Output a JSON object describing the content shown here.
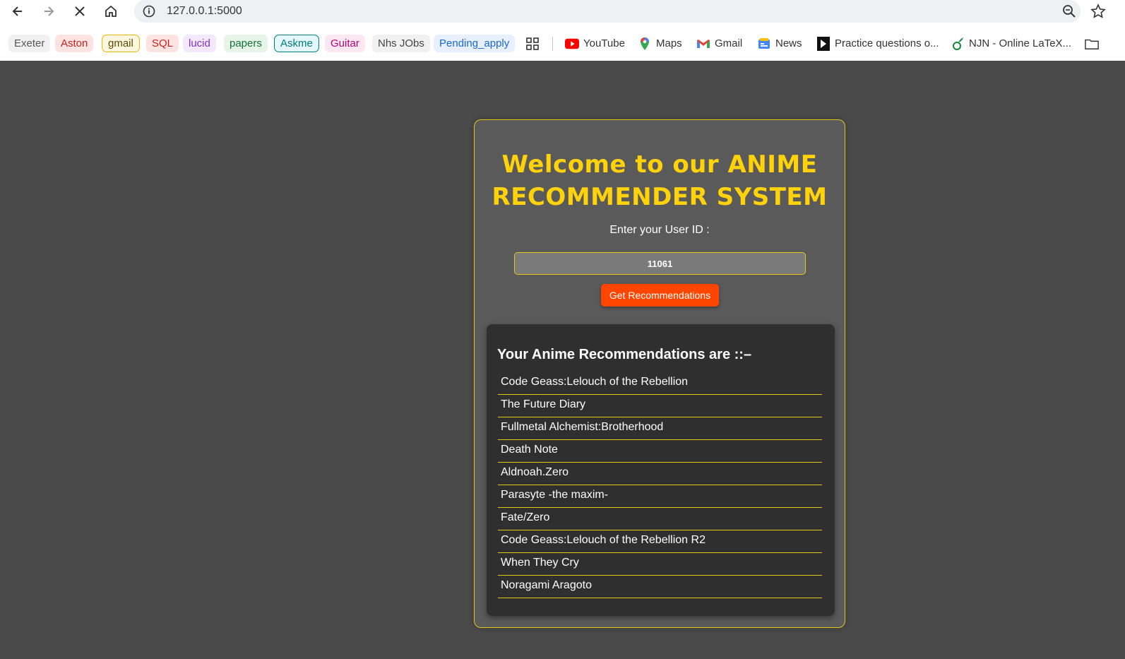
{
  "browser": {
    "url": "127.0.0.1:5000",
    "icons": {
      "back": "back-arrow-icon",
      "forward": "forward-arrow-icon",
      "stop": "close-icon",
      "home": "home-icon",
      "info": "info-icon",
      "zoom": "zoom-icon",
      "star": "star-icon",
      "apps": "apps-grid-icon",
      "folder": "folder-icon"
    }
  },
  "bookmarks": {
    "chips": [
      {
        "label": "Exeter",
        "bg": "#f1f1f1",
        "color": "#555555"
      },
      {
        "label": "Aston",
        "bg": "#fde3e1",
        "color": "#c5221f"
      },
      {
        "label": "gmail",
        "bg": "#fef7e0",
        "color": "#5f4b00",
        "border": "#f2b705"
      },
      {
        "label": "SQL",
        "bg": "#fde3e1",
        "color": "#c5221f"
      },
      {
        "label": "lucid",
        "bg": "#f3e8fd",
        "color": "#8430ce"
      },
      {
        "label": "papers",
        "bg": "#e6f4ea",
        "color": "#137333"
      },
      {
        "label": "Askme",
        "bg": "#e4f7fb",
        "color": "#007b83",
        "border": "#007b83"
      },
      {
        "label": "Guitar",
        "bg": "#fde7f3",
        "color": "#b80672"
      },
      {
        "label": "Nhs JObs",
        "bg": "#f1f1f1",
        "color": "#444444"
      },
      {
        "label": "Pending_apply",
        "bg": "#e8f0fe",
        "color": "#1967d2"
      }
    ],
    "links": [
      {
        "label": "YouTube",
        "icon": "youtube-icon"
      },
      {
        "label": "Maps",
        "icon": "maps-pin-icon"
      },
      {
        "label": "Gmail",
        "icon": "gmail-icon"
      },
      {
        "label": "News",
        "icon": "news-icon"
      },
      {
        "label": "Practice questions o...",
        "icon": "practice-site-icon"
      },
      {
        "label": "NJN - Online LaTeX...",
        "icon": "overleaf-icon"
      }
    ]
  },
  "app": {
    "title": "Welcome to our ANIME RECOMMENDER SYSTEM",
    "user_id_label": "Enter your User ID :",
    "user_id_value": "11061",
    "button_label": "Get Recommendations",
    "results_heading": "Your Anime Recommendations are ::–",
    "recommendations": [
      "Code Geass:Lelouch of the Rebellion",
      "The Future Diary",
      "Fullmetal Alchemist:Brotherhood",
      "Death Note",
      "Aldnoah.Zero",
      "Parasyte -the maxim-",
      "Fate/Zero",
      "Code Geass:Lelouch of the Rebellion R2",
      "When They Cry",
      "Noragami Aragoto"
    ],
    "colors": {
      "accent_yellow": "#ffd20a",
      "button_orange": "#ff4500",
      "page_bg": "#4a4a4a"
    }
  }
}
